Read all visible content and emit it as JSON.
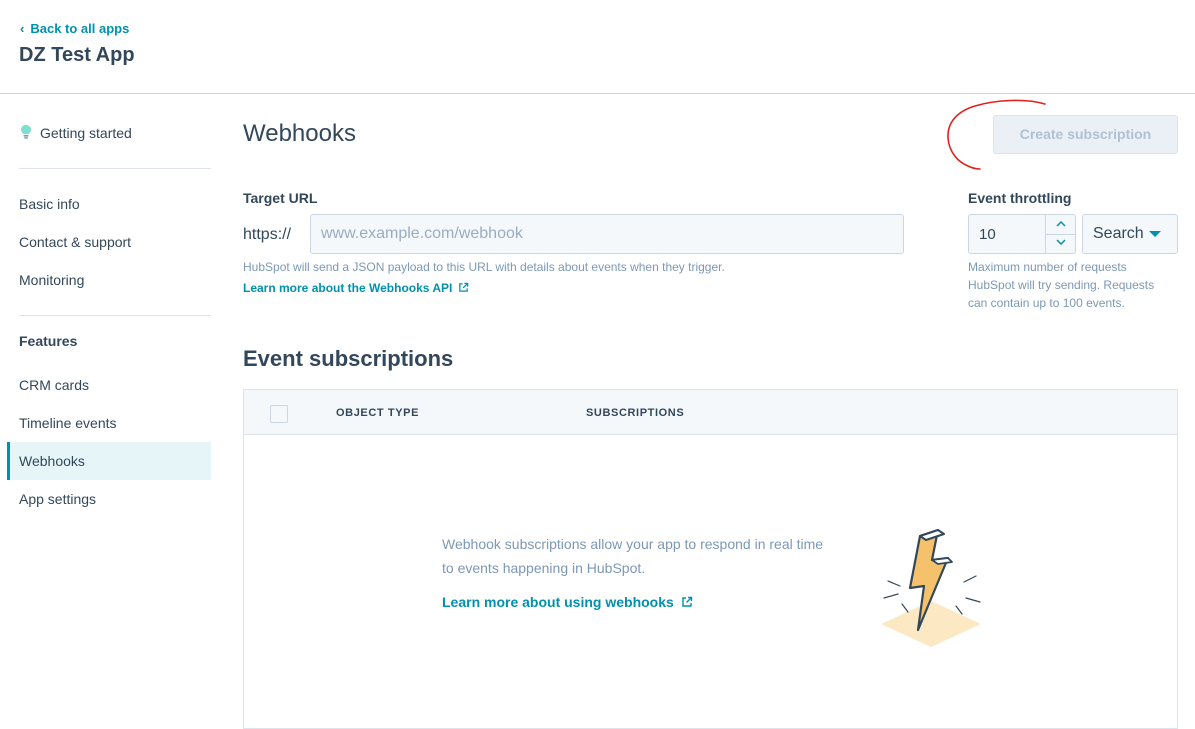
{
  "header": {
    "back_label": "Back to all apps",
    "app_title": "DZ Test App"
  },
  "sidebar": {
    "getting_started": "Getting started",
    "items": [
      "Basic info",
      "Contact & support",
      "Monitoring"
    ],
    "features_heading": "Features",
    "feature_items": [
      "CRM cards",
      "Timeline events",
      "Webhooks",
      "App settings"
    ],
    "active_item": "Webhooks"
  },
  "main": {
    "title": "Webhooks",
    "create_button": "Create subscription",
    "target_url": {
      "label": "Target URL",
      "prefix": "https://",
      "placeholder": "www.example.com/webhook",
      "help": "HubSpot will send a JSON payload to this URL with details about events when they trigger.",
      "learn_more": "Learn more about the Webhooks API"
    },
    "throttling": {
      "label": "Event throttling",
      "value": "10",
      "mode": "Search",
      "help_lines": [
        "Maximum number of requests",
        "HubSpot will try sending. Requests",
        "can contain up to 100 events."
      ]
    },
    "subscriptions": {
      "title": "Event subscriptions",
      "columns": [
        "OBJECT TYPE",
        "SUBSCRIPTIONS"
      ],
      "empty_text": "Webhook subscriptions allow your app to respond in real time to events happening in HubSpot.",
      "empty_link": "Learn more about using webhooks"
    }
  },
  "colors": {
    "accent": "#0091ae",
    "text": "#33475b",
    "muted": "#7c98b6",
    "annotation": "#e0201b"
  }
}
